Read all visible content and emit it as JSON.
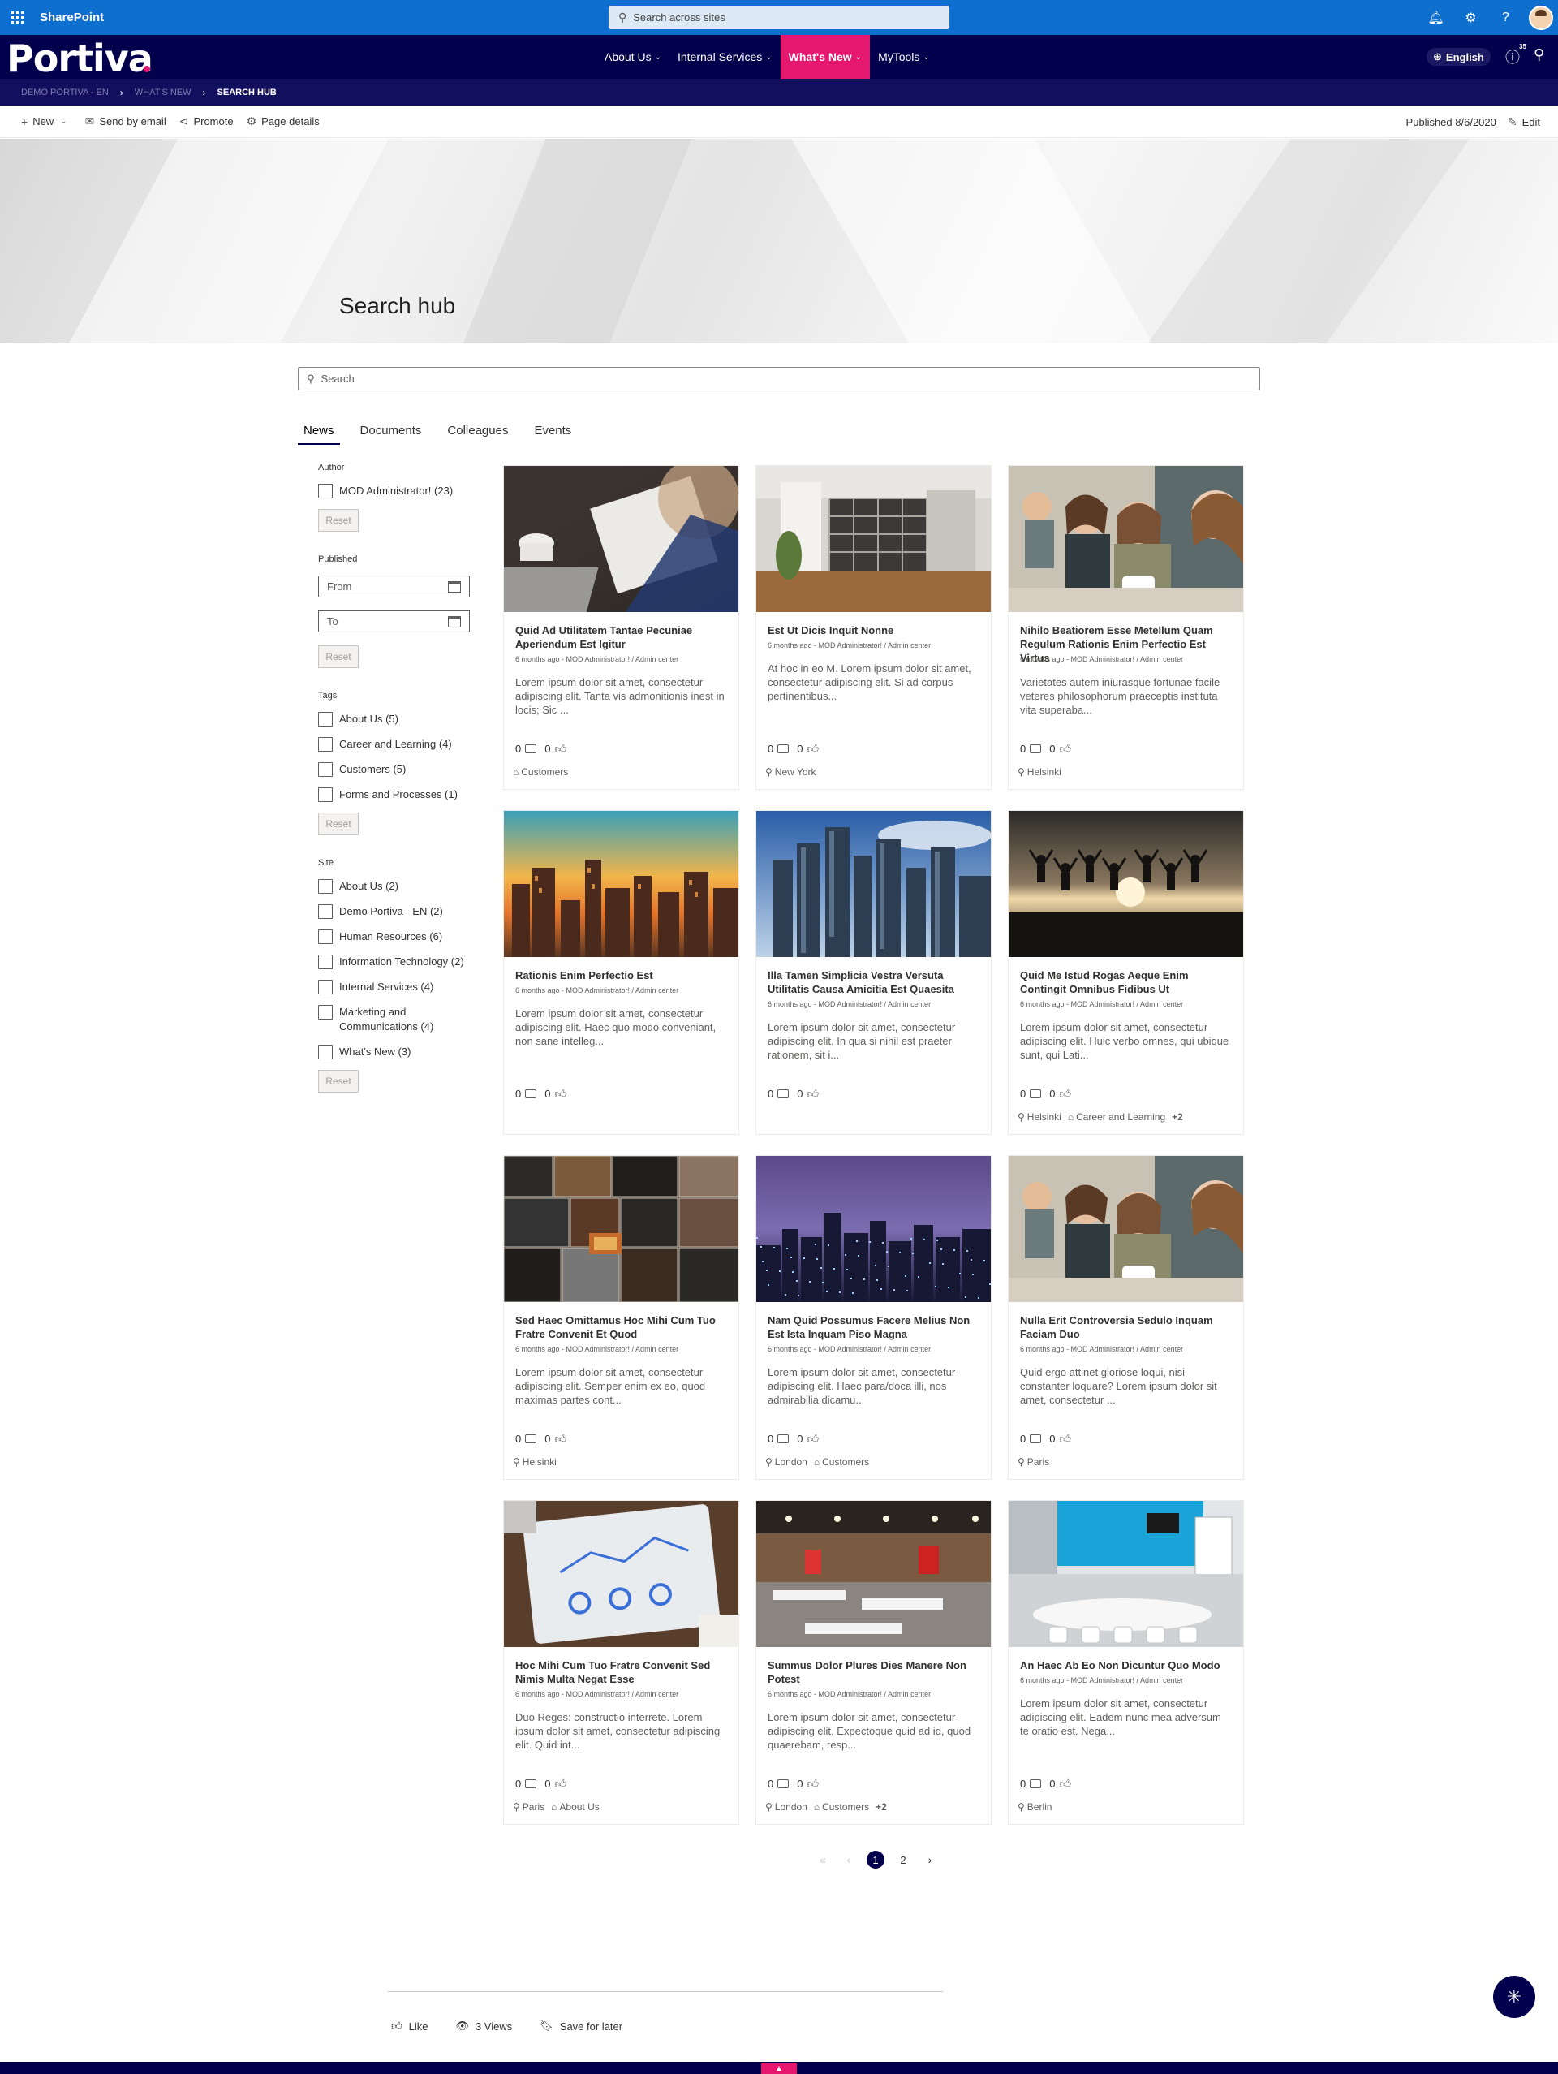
{
  "suite": {
    "app_name": "SharePoint",
    "search_placeholder": "Search across sites"
  },
  "brand": {
    "logo_text": "Portiva",
    "nav": [
      {
        "label": "About Us"
      },
      {
        "label": "Internal Services"
      },
      {
        "label": "What's New"
      },
      {
        "label": "MyTools"
      }
    ],
    "language": "English",
    "notification_count": "35"
  },
  "breadcrumb": [
    "DEMO PORTIVA - EN",
    "WHAT'S NEW",
    "SEARCH HUB"
  ],
  "commands": {
    "new": "New",
    "send_by_email": "Send by email",
    "promote": "Promote",
    "page_details": "Page details",
    "published": "Published 8/6/2020",
    "edit": "Edit"
  },
  "hero": {
    "title": "Search hub"
  },
  "search": {
    "placeholder": "Search"
  },
  "tabs": [
    "News",
    "Documents",
    "Colleagues",
    "Events"
  ],
  "refiners": {
    "author_title": "Author",
    "authors": [
      "MOD Administrator! (23)"
    ],
    "published_title": "Published",
    "from_placeholder": "From",
    "to_placeholder": "To",
    "tags_title": "Tags",
    "tags": [
      "About Us (5)",
      "Career and Learning (4)",
      "Customers (5)",
      "Forms and Processes (1)"
    ],
    "site_title": "Site",
    "sites": [
      "About Us (2)",
      "Demo Portiva - EN (2)",
      "Human Resources (6)",
      "Information Technology (2)",
      "Internal Services (4)",
      "Marketing and Communications (4)",
      "What's New (3)"
    ],
    "reset_label": "Reset"
  },
  "cards": [
    {
      "title": "Quid Ad Utilitatem Tantae Pecuniae Aperiendum Est Igitur",
      "meta": "6 months ago - MOD Administrator! / Admin center",
      "desc": "Lorem ipsum dolor sit amet, consectetur adipiscing elit. Tanta vis admonitionis inest in locis; Sic ...",
      "comments": "0",
      "likes": "0",
      "location": "",
      "tags": [
        "Customers"
      ],
      "more": "",
      "image": "office-desk"
    },
    {
      "title": "Est Ut Dicis Inquit Nonne",
      "meta": "6 months ago - MOD Administrator! / Admin center",
      "desc": "At hoc in eo M. Lorem ipsum dolor sit amet, consectetur adipiscing elit. Si ad corpus pertinentibus...",
      "comments": "0",
      "likes": "0",
      "location": "New York",
      "tags": [],
      "more": "",
      "image": "office-room"
    },
    {
      "title": "Nihilo Beatiorem Esse Metellum Quam Regulum Rationis Enim Perfectio Est Virtus",
      "meta": "6 months ago - MOD Administrator! / Admin center",
      "desc": "Varietates autem iniurasque fortunae facile veteres philosophorum praeceptis instituta vita superaba...",
      "comments": "0",
      "likes": "0",
      "location": "Helsinki",
      "tags": [],
      "more": "",
      "image": "people-laughing"
    },
    {
      "title": "Rationis Enim Perfectio Est",
      "meta": "6 months ago - MOD Administrator! / Admin center",
      "desc": "Lorem ipsum dolor sit amet, consectetur adipiscing elit. Haec quo modo conveniant, non sane intelleg...",
      "comments": "0",
      "likes": "0",
      "location": "",
      "tags": [],
      "more": "",
      "image": "city-sunset"
    },
    {
      "title": "Illa Tamen Simplicia Vestra Versuta Utilitatis Causa Amicitia Est Quaesita",
      "meta": "6 months ago - MOD Administrator! / Admin center",
      "desc": "Lorem ipsum dolor sit amet, consectetur adipiscing elit. In qua si nihil est praeter rationem, sit i...",
      "comments": "0",
      "likes": "0",
      "location": "",
      "tags": [],
      "more": "",
      "image": "skyscrapers"
    },
    {
      "title": "Quid Me Istud Rogas Aeque Enim Contingit Omnibus Fidibus Ut",
      "meta": "6 months ago - MOD Administrator! / Admin center",
      "desc": "Lorem ipsum dolor sit amet, consectetur adipiscing elit. Huic verbo omnes, qui ubique sunt, qui Lati...",
      "comments": "0",
      "likes": "0",
      "location": "Helsinki",
      "tags": [
        "Career and Learning"
      ],
      "more": "+2",
      "image": "jumping-people"
    },
    {
      "title": "Sed Haec Omittamus Hoc Mihi Cum Tuo Fratre Convenit Et Quod",
      "meta": "6 months ago - MOD Administrator! / Admin center",
      "desc": "Lorem ipsum dolor sit amet, consectetur adipiscing elit. Semper enim ex eo, quod maximas partes cont...",
      "comments": "0",
      "likes": "0",
      "location": "Helsinki",
      "tags": [],
      "more": "",
      "image": "amplifiers"
    },
    {
      "title": "Nam Quid Possumus Facere Melius Non Est Ista Inquam Piso Magna",
      "meta": "6 months ago - MOD Administrator! / Admin center",
      "desc": "Lorem ipsum dolor sit amet, consectetur adipiscing elit. Haec para/doca illi, nos admirabilia dicamu...",
      "comments": "0",
      "likes": "0",
      "location": "London",
      "tags": [
        "Customers"
      ],
      "more": "",
      "image": "city-night"
    },
    {
      "title": "Nulla Erit Controversia Sedulo Inquam Faciam Duo",
      "meta": "6 months ago - MOD Administrator! / Admin center",
      "desc": "Quid ergo attinet gloriose loqui, nisi constanter loquare? Lorem ipsum dolor sit amet, consectetur ...",
      "comments": "0",
      "likes": "0",
      "location": "Paris",
      "tags": [],
      "more": "",
      "image": "people-laughing"
    },
    {
      "title": "Hoc Mihi Cum Tuo Fratre Convenit Sed Nimis Multa Negat Esse",
      "meta": "6 months ago - MOD Administrator! / Admin center",
      "desc": "Duo Reges: constructio interrete. Lorem ipsum dolor sit amet, consectetur adipiscing elit. Quid int...",
      "comments": "0",
      "likes": "0",
      "location": "Paris",
      "tags": [
        "About Us"
      ],
      "more": "",
      "image": "tablet-charts"
    },
    {
      "title": "Summus Dolor Plures Dies Manere Non Potest",
      "meta": "6 months ago - MOD Administrator! / Admin center",
      "desc": "Lorem ipsum dolor sit amet, consectetur adipiscing elit. Expectoque quid ad id, quod quaerebam, resp...",
      "comments": "0",
      "likes": "0",
      "location": "London",
      "tags": [
        "Customers"
      ],
      "more": "+2",
      "image": "open-office"
    },
    {
      "title": "An Haec Ab Eo Non Dicuntur Quo Modo",
      "meta": "6 months ago - MOD Administrator! / Admin center",
      "desc": "Lorem ipsum dolor sit amet, consectetur adipiscing elit. Eadem nunc mea adversum te oratio est. Nega...",
      "comments": "0",
      "likes": "0",
      "location": "Berlin",
      "tags": [],
      "more": "",
      "image": "meeting-room"
    }
  ],
  "pagination": {
    "pages": [
      "1",
      "2"
    ],
    "current": "1"
  },
  "footer": {
    "like": "Like",
    "views": "3 Views",
    "save": "Save for later"
  }
}
